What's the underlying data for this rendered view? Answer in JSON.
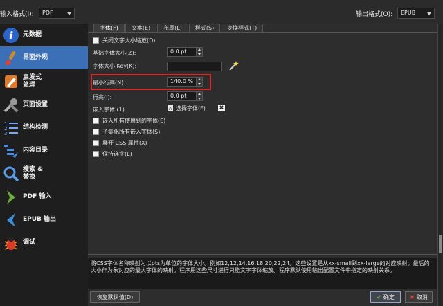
{
  "input_format": {
    "label": "输入格式(I):",
    "value": "PDF"
  },
  "output_format": {
    "label": "输出格式(O):",
    "value": "EPUB"
  },
  "sidebar": {
    "items": [
      {
        "label": "元数据",
        "icon": "info-icon"
      },
      {
        "label": "界面外观",
        "icon": "paintbrush-icon",
        "selected": true
      },
      {
        "label": "启发式\n处理",
        "icon": "pencil-icon"
      },
      {
        "label": "页面设置",
        "icon": "tools-icon"
      },
      {
        "label": "结构检测",
        "icon": "numbered-list-icon"
      },
      {
        "label": "内容目录",
        "icon": "toc-icon"
      },
      {
        "label": "搜索 &\n替换",
        "icon": "magnifier-icon"
      },
      {
        "label": "PDF 输入",
        "icon": "arrow-in-icon"
      },
      {
        "label": "EPUB 输出",
        "icon": "arrow-out-icon"
      },
      {
        "label": "调试",
        "icon": "bug-icon"
      }
    ]
  },
  "tabs": [
    {
      "label": "字体(F)",
      "active": true
    },
    {
      "label": "文本(E)"
    },
    {
      "label": "布局(L)"
    },
    {
      "label": "样式(S)"
    },
    {
      "label": "变换样式(T)"
    }
  ],
  "font": {
    "disable_scaling_label": "关闭文字大小缩放(D)",
    "base_size_label": "基础字体大小(Z):",
    "base_size_value": "0.0 pt",
    "key_label": "字体大小 Key(K):",
    "key_value": "",
    "min_line_height_label": "最小行高(N):",
    "min_line_height_value": "140.0 %",
    "line_height_label": "行高(I):",
    "line_height_value": "0.0 pt",
    "embed_font_label": "嵌入字体 (1)",
    "choose_font_label": "选择字体(F)",
    "embed_all_label": "嵌入所有使用到的字体(E)",
    "subset_label": "子集化所有嵌入字体(S)",
    "expand_css_label": "展开 CSS 属性(X)",
    "keep_ligatures_label": "保持连字(L)"
  },
  "help_text": "将CSS字体名称映射为以pts为单位的字体大小。例如12,12,14,16,18,20,22,24。这些设置是从xx-small到xx-large的对应映射。最后的大小作为象对应的最大字体的映射。程序用这些尺寸进行只能文字字体缩放。程序默认使用输出配置文件中指定的映射关系。",
  "buttons": {
    "restore": "恢复默认值(D)",
    "ok": "确定",
    "cancel": "取消"
  },
  "colors": {
    "selection": "#3b6fb6",
    "highlight_box": "#d42a2a"
  }
}
